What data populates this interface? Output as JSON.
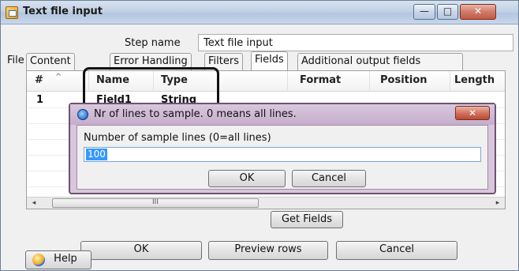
{
  "window": {
    "title": "Text file input",
    "controls": {
      "minimize": "—",
      "maximize": "□",
      "close": "✕"
    }
  },
  "step": {
    "label": "Step name",
    "value": "Text file input"
  },
  "tabs": [
    {
      "label": "File"
    },
    {
      "label": "Content"
    },
    {
      "label": "Error Handling"
    },
    {
      "label": "Filters"
    },
    {
      "label": "Fields",
      "active": true
    },
    {
      "label": "Additional output fields"
    }
  ],
  "table": {
    "sort_indicator": "^",
    "columns": [
      "#",
      "Name",
      "Type",
      "Format",
      "Position",
      "Length"
    ],
    "rows": [
      {
        "num": "1",
        "name": "Field1",
        "type": "String"
      }
    ],
    "scroll_thumb_grip": "III",
    "scroll_left": "◂",
    "scroll_right": "▸"
  },
  "sample_dialog": {
    "title": "Nr of lines to sample.  0 means all lines.",
    "close": "✕",
    "label": "Number of sample lines (0=all lines)",
    "value": "100",
    "ok": "OK",
    "cancel": "Cancel"
  },
  "buttons": {
    "get_fields": "Get Fields",
    "ok": "OK",
    "preview": "Preview rows",
    "cancel": "Cancel",
    "help": "Help"
  }
}
